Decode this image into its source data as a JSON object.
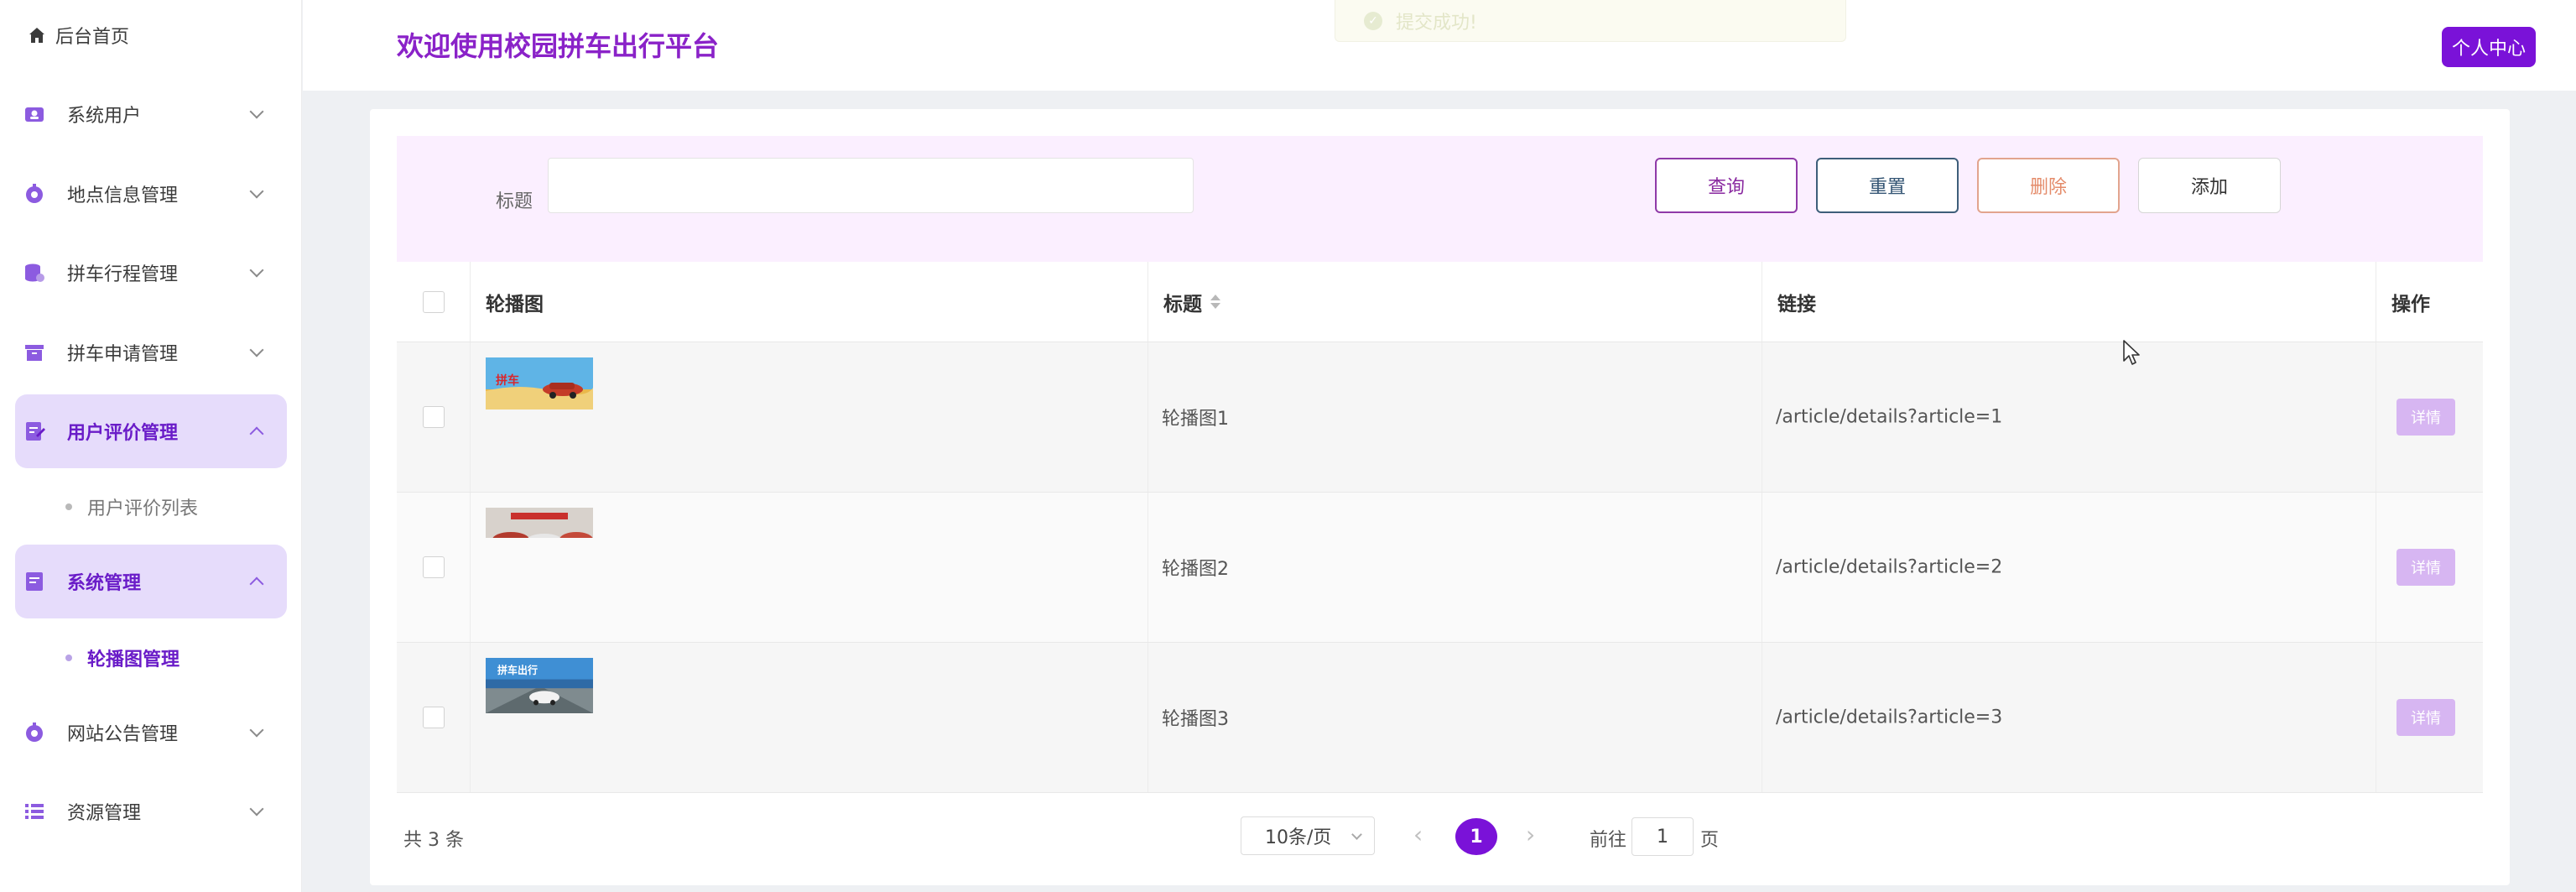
{
  "sidebar": {
    "home_label": "后台首页",
    "items": [
      {
        "label": "系统用户",
        "icon": "user-card-icon",
        "expanded": false
      },
      {
        "label": "地点信息管理",
        "icon": "location-icon",
        "expanded": false
      },
      {
        "label": "拼车行程管理",
        "icon": "database-icon",
        "expanded": false
      },
      {
        "label": "拼车申请管理",
        "icon": "archive-icon",
        "expanded": false
      },
      {
        "label": "用户评价管理",
        "icon": "review-icon",
        "expanded": true,
        "children": [
          {
            "label": "用户评价列表",
            "active": false
          }
        ]
      },
      {
        "label": "系统管理",
        "icon": "document-icon",
        "expanded": true,
        "children": [
          {
            "label": "轮播图管理",
            "active": true
          }
        ]
      },
      {
        "label": "网站公告管理",
        "icon": "announcement-icon",
        "expanded": false
      },
      {
        "label": "资源管理",
        "icon": "list-icon",
        "expanded": false
      }
    ]
  },
  "header": {
    "title": "欢迎使用校园拼车出行平台",
    "personal_center": "个人中心",
    "toast": "提交成功!"
  },
  "filter": {
    "title_label": "标题",
    "title_value": "",
    "query": "查询",
    "reset": "重置",
    "delete": "删除",
    "add": "添加"
  },
  "table": {
    "columns": [
      "轮播图",
      "标题",
      "链接",
      "操作"
    ],
    "rows": [
      {
        "title": "轮播图1",
        "link": "/article/details?article=1",
        "action": "详情"
      },
      {
        "title": "轮播图2",
        "link": "/article/details?article=2",
        "action": "详情"
      },
      {
        "title": "轮播图3",
        "link": "/article/details?article=3",
        "action": "详情"
      }
    ]
  },
  "pagination": {
    "total": "共 3 条",
    "page_size": "10条/页",
    "current_page": "1",
    "goto_prefix": "前往",
    "goto_value": "1",
    "goto_suffix": "页"
  },
  "colors": {
    "accent": "#7a12d8",
    "title": "#8a22c8",
    "filter_bg": "#fbefff",
    "active_menu_bg": "#e6dcfb"
  }
}
